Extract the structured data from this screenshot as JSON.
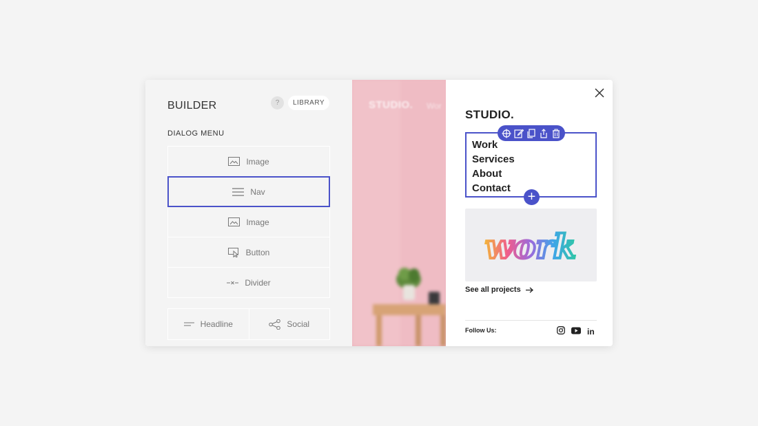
{
  "builder": {
    "title": "BUILDER",
    "help_label": "?",
    "library_label": "LIBRARY",
    "section_label": "DIALOG MENU",
    "blocks": [
      {
        "label": "Image",
        "icon": "image-icon"
      },
      {
        "label": "Nav",
        "icon": "menu-icon",
        "selected": true
      },
      {
        "label": "Image",
        "icon": "image-icon"
      },
      {
        "label": "Button",
        "icon": "cursor-click-icon"
      },
      {
        "label": "Divider",
        "icon": "divider-icon"
      }
    ],
    "pair_blocks": [
      {
        "label": "Headline",
        "icon": "headline-icon"
      },
      {
        "label": "Social",
        "icon": "share-icon"
      }
    ]
  },
  "photo": {
    "brand": "STUDIO.",
    "nav_text": "Wor"
  },
  "preview": {
    "logo": "STUDIO.",
    "nav_links": [
      "Work",
      "Services",
      "About",
      "Contact"
    ],
    "toolbar_icons": [
      "move-icon",
      "edit-icon",
      "duplicate-icon",
      "share-icon",
      "delete-icon"
    ],
    "add_label": "+",
    "hero_text": "work",
    "see_all": "See all projects",
    "follow_label": "Follow Us:",
    "social_icons": [
      "instagram-icon",
      "youtube-icon",
      "linkedin-icon"
    ],
    "linkedin_text": "in"
  },
  "colors": {
    "accent": "#4a52c9",
    "panel_bg": "#f4f4f4",
    "photo_pink": "#eeb9c1"
  }
}
